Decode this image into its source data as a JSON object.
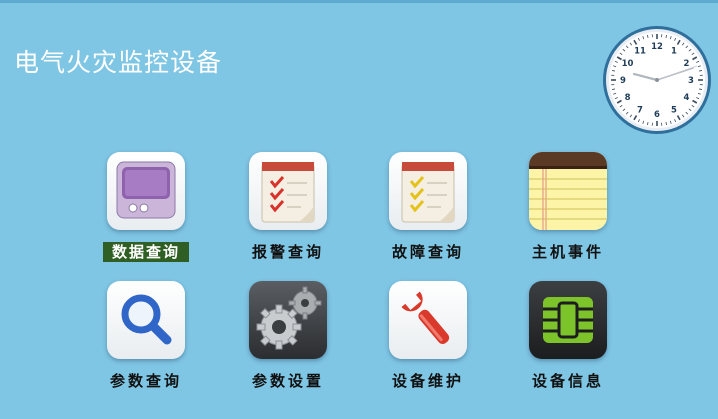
{
  "app": {
    "title": "电气火灾监控设备"
  },
  "clock": {
    "numerals": [
      "12",
      "1",
      "2",
      "3",
      "4",
      "5",
      "6",
      "7",
      "8",
      "9",
      "10",
      "11"
    ]
  },
  "menu": {
    "items": [
      {
        "label": "数据查询",
        "icon": "monitor-icon",
        "selected": true
      },
      {
        "label": "报警查询",
        "icon": "checklist-notepad-icon",
        "selected": false
      },
      {
        "label": "故障查询",
        "icon": "checklist-notepad-icon",
        "selected": false
      },
      {
        "label": "主机事件",
        "icon": "legal-pad-icon",
        "selected": false
      },
      {
        "label": "参数查询",
        "icon": "magnifier-icon",
        "selected": false
      },
      {
        "label": "参数设置",
        "icon": "gears-icon",
        "selected": false
      },
      {
        "label": "设备维护",
        "icon": "wrench-icon",
        "selected": false
      },
      {
        "label": "设备信息",
        "icon": "chip-icon",
        "selected": false
      }
    ]
  },
  "colors": {
    "background": "#7fc6e4",
    "selected_label_bg": "#2f5f25",
    "checkmark_red": "#d8322a",
    "checkmark_yellow": "#e4c21a",
    "chip_green": "#7dc42a"
  }
}
